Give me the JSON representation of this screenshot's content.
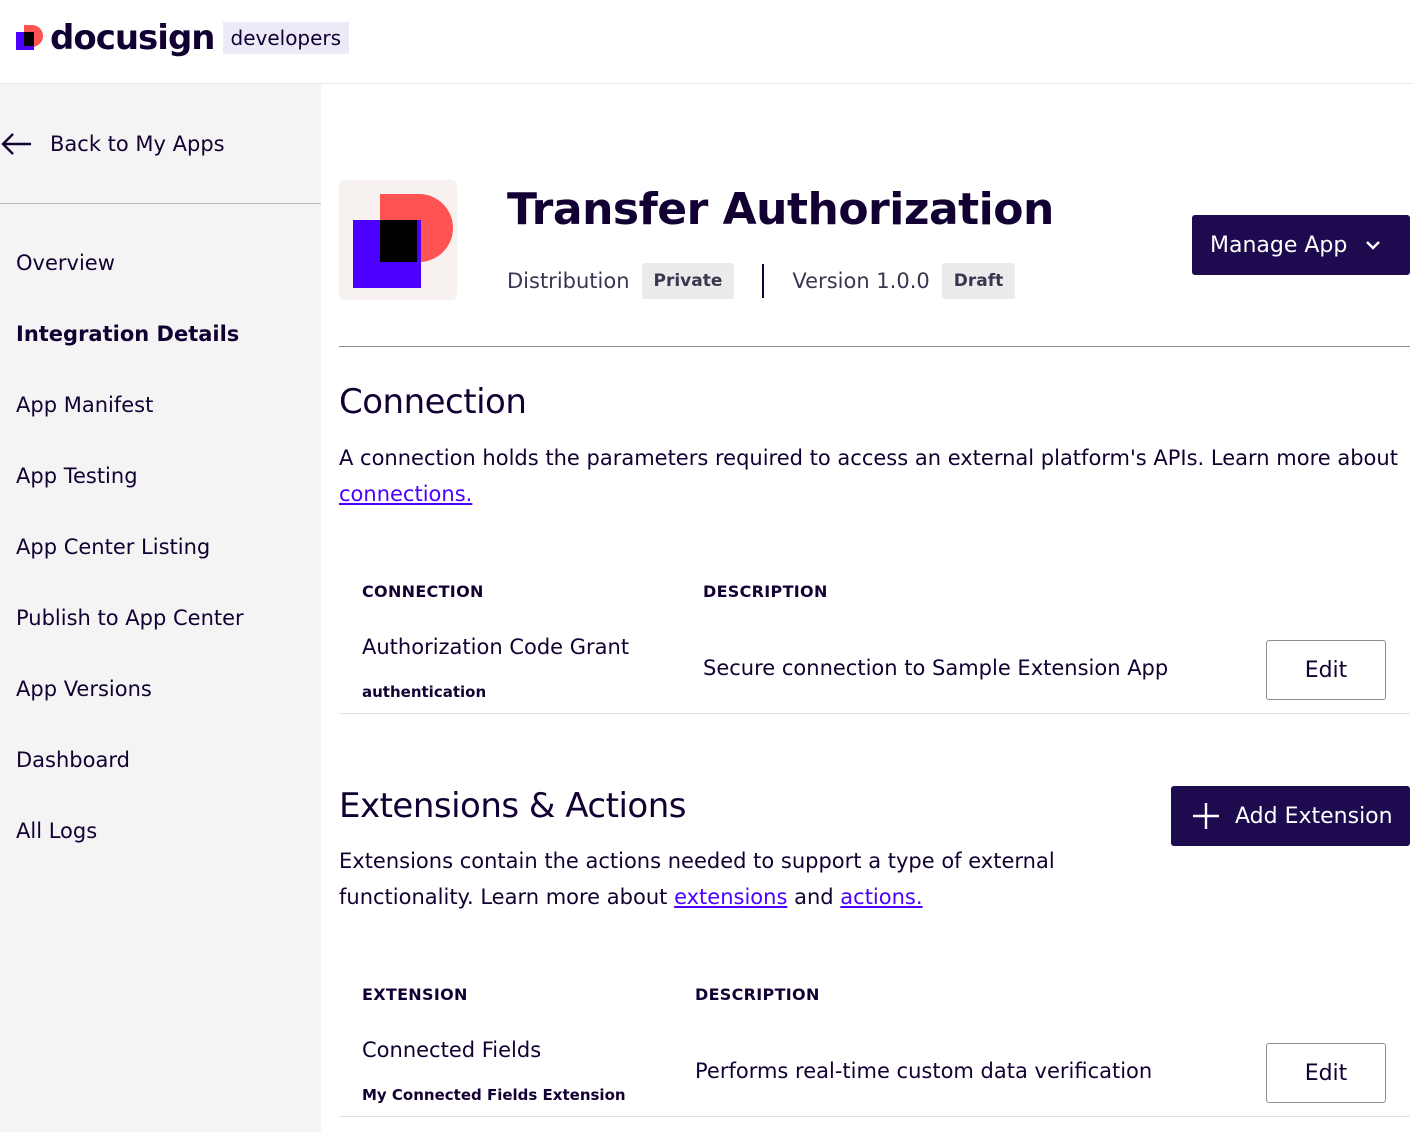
{
  "header": {
    "brand": "docusign",
    "badge": "developers",
    "colors": {
      "brand_red": "#ff5252",
      "brand_purple": "#4c00ff",
      "brand_black": "#000000"
    }
  },
  "sidebar": {
    "back_label": "Back to My Apps",
    "items": [
      {
        "label": "Overview",
        "active": false
      },
      {
        "label": "Integration Details",
        "active": true
      },
      {
        "label": "App Manifest",
        "active": false
      },
      {
        "label": "App Testing",
        "active": false
      },
      {
        "label": "App Center Listing",
        "active": false
      },
      {
        "label": "Publish to App Center",
        "active": false
      },
      {
        "label": "App Versions",
        "active": false
      },
      {
        "label": "Dashboard",
        "active": false
      },
      {
        "label": "All Logs",
        "active": false
      }
    ]
  },
  "app": {
    "title": "Transfer Authorization",
    "distribution_label": "Distribution",
    "distribution_value": "Private",
    "version_label": "Version 1.0.0",
    "version_status": "Draft",
    "manage_button": "Manage App"
  },
  "connection": {
    "heading": "Connection",
    "description": "A connection holds the parameters required to access an external platform's APIs. Learn more about",
    "link": "connections.",
    "columns": [
      "CONNECTION",
      "DESCRIPTION"
    ],
    "rows": [
      {
        "name": "Authorization Code Grant",
        "type": "authentication",
        "description": "Secure connection to Sample Extension App",
        "action": "Edit"
      }
    ]
  },
  "extensions": {
    "heading": "Extensions & Actions",
    "add_button": "Add Extension",
    "description_line1": "Extensions contain the actions needed to support a type of external",
    "description_line2": "functionality. Learn more about",
    "link1": "extensions",
    "conj": "and",
    "link2": "actions.",
    "columns": [
      "EXTENSION",
      "DESCRIPTION"
    ],
    "rows": [
      {
        "name": "Connected Fields",
        "subtitle": "My Connected Fields Extension",
        "description": "Performs real-time custom data verification",
        "action": "Edit"
      }
    ]
  }
}
